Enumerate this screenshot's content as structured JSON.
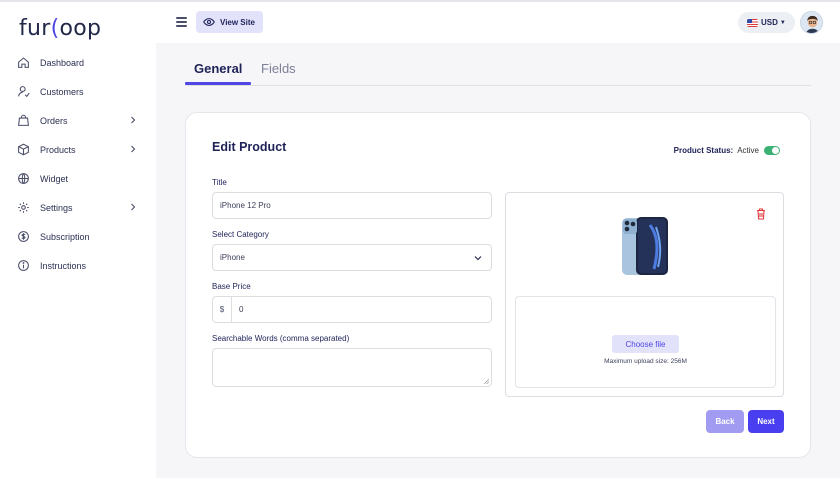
{
  "brand": {
    "logo_left": "fur",
    "logo_mid": "(",
    "logo_right": "oop"
  },
  "sidebar": {
    "items": [
      {
        "label": "Dashboard",
        "icon": "home-icon",
        "has_submenu": false
      },
      {
        "label": "Customers",
        "icon": "user-icon",
        "has_submenu": false
      },
      {
        "label": "Orders",
        "icon": "shopping-bag-icon",
        "has_submenu": true
      },
      {
        "label": "Products",
        "icon": "box-icon",
        "has_submenu": true
      },
      {
        "label": "Widget",
        "icon": "globe-icon",
        "has_submenu": false
      },
      {
        "label": "Settings",
        "icon": "gear-icon",
        "has_submenu": true
      },
      {
        "label": "Subscription",
        "icon": "dollar-icon",
        "has_submenu": false
      },
      {
        "label": "Instructions",
        "icon": "info-icon",
        "has_submenu": false
      }
    ]
  },
  "topbar": {
    "view_site_label": "View Site",
    "currency": "USD",
    "currency_flag": "us-flag-icon"
  },
  "tabs": [
    {
      "label": "General",
      "active": true
    },
    {
      "label": "Fields",
      "active": false
    }
  ],
  "form": {
    "title": "Edit Product",
    "status_label": "Product Status:",
    "status_value": "Active",
    "status_on": true,
    "title_label": "Title",
    "title_value": "iPhone 12 Pro",
    "category_label": "Select Category",
    "category_value": "iPhone",
    "price_label": "Base Price",
    "price_prefix": "$",
    "price_value": "0",
    "keywords_label": "Searchable Words (comma separated)",
    "keywords_value": ""
  },
  "media": {
    "choose_label": "Choose file",
    "hint": "Maximum upload size: 256M"
  },
  "actions": {
    "back_label": "Back",
    "next_label": "Next"
  },
  "colors": {
    "accent": "#4f46e5",
    "toggle_on": "#3bb273",
    "delete": "#e0393e",
    "next_button": "#4a3ff0",
    "back_button": "#a19cf2"
  }
}
